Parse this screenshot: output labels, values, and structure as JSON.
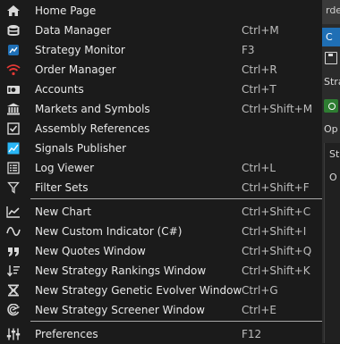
{
  "background_app": {
    "title_fragment": "rder",
    "tab_fragment": "C",
    "text_fragments": [
      "Stra",
      "Op",
      "St",
      "O"
    ]
  },
  "menu": {
    "groups": [
      [
        {
          "label": "Home Page",
          "shortcut": "",
          "icon": "home-icon"
        },
        {
          "label": "Data Manager",
          "shortcut": "Ctrl+M",
          "icon": "database-icon"
        },
        {
          "label": "Strategy Monitor",
          "shortcut": "F3",
          "icon": "monitor-icon"
        },
        {
          "label": "Order Manager",
          "shortcut": "Ctrl+R",
          "icon": "wifi-icon"
        },
        {
          "label": "Accounts",
          "shortcut": "Ctrl+T",
          "icon": "money-icon"
        },
        {
          "label": "Markets and Symbols",
          "shortcut": "Ctrl+Shift+M",
          "icon": "bank-icon"
        },
        {
          "label": "Assembly References",
          "shortcut": "",
          "icon": "checkbox-icon"
        },
        {
          "label": "Signals Publisher",
          "shortcut": "",
          "icon": "signal-chart-icon"
        },
        {
          "label": "Log Viewer",
          "shortcut": "Ctrl+L",
          "icon": "list-icon"
        },
        {
          "label": "Filter Sets",
          "shortcut": "Ctrl+Shift+F",
          "icon": "filter-icon"
        }
      ],
      [
        {
          "label": "New Chart",
          "shortcut": "Ctrl+Shift+C",
          "icon": "chart-line-icon"
        },
        {
          "label": "New Custom Indicator (C#)",
          "shortcut": "Ctrl+Shift+I",
          "icon": "wave-icon"
        },
        {
          "label": "New Quotes Window",
          "shortcut": "Ctrl+Shift+Q",
          "icon": "quote-icon"
        },
        {
          "label": "New Strategy Rankings Window",
          "shortcut": "Ctrl+Shift+K",
          "icon": "sort-icon"
        },
        {
          "label": "New Strategy Genetic Evolver Window",
          "shortcut": "Ctrl+G",
          "icon": "dna-icon"
        },
        {
          "label": "New Strategy Screener Window",
          "shortcut": "Ctrl+E",
          "icon": "screener-icon"
        }
      ],
      [
        {
          "label": "Preferences",
          "shortcut": "F12",
          "icon": "sliders-icon"
        }
      ]
    ]
  },
  "colors": {
    "menu_bg": "#1b1b1b",
    "separator": "#a9a9a9",
    "accent_blue": "#1f6fb5",
    "accent_red": "#e53935",
    "accent_green": "#2e7d32"
  }
}
